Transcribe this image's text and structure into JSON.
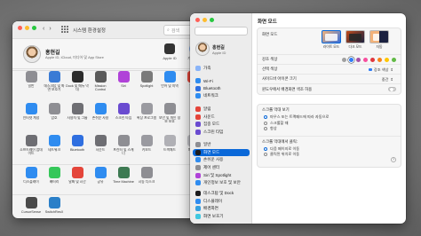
{
  "sysprefs": {
    "title": "시스템 환경설정",
    "search_placeholder": "검색",
    "account": {
      "name": "홍현길",
      "subtitle": "Apple ID, iCloud, 미디어 및 App Store",
      "tiles": [
        {
          "label": "Apple ID",
          "icon": "apple-icon"
        },
        {
          "label": "가족 공유",
          "icon": "family-icon"
        }
      ]
    },
    "rows": [
      [
        {
          "label": "일반",
          "icon": "general-icon",
          "color": "#8e8e93"
        },
        {
          "label": "데스크탑 및 화면 보호기",
          "icon": "desktop-icon",
          "color": "#3a7bd5"
        },
        {
          "label": "Dock 및 메뉴 막대",
          "icon": "dock-icon",
          "color": "#2b2b2b"
        },
        {
          "label": "Mission Control",
          "icon": "mission-control-icon",
          "color": "#5a5a5a"
        },
        {
          "label": "Siri",
          "icon": "siri-icon",
          "color": "#b042d8"
        },
        {
          "label": "Spotlight",
          "icon": "spotlight-icon",
          "color": "#7a7a7a"
        },
        {
          "label": "언어 및 지역",
          "icon": "globe-icon",
          "color": "#2f8cf0"
        },
        {
          "label": "알림",
          "icon": "bell-icon",
          "color": "#e4453a"
        }
      ],
      [
        {
          "label": "인터넷 계정",
          "icon": "at-icon",
          "color": "#2f8cf0"
        },
        {
          "label": "암호",
          "icon": "key-icon",
          "color": "#8e8e93"
        },
        {
          "label": "사용자 및 그룹",
          "icon": "users-icon",
          "color": "#6e6e73"
        },
        {
          "label": "손쉬운 사용",
          "icon": "accessibility-icon",
          "color": "#2f8cf0"
        },
        {
          "label": "스크린 타임",
          "icon": "hourglass-icon",
          "color": "#6a4bd0"
        },
        {
          "label": "확장 프로그램",
          "icon": "puzzle-icon",
          "color": "#9a9aa0"
        },
        {
          "label": "보안 및 개인 정보 보호",
          "icon": "house-icon",
          "color": "#8e8e93"
        }
      ],
      [
        {
          "label": "소프트웨어 업데이트",
          "icon": "gear-icon",
          "color": "#6e6e73"
        },
        {
          "label": "네트워크",
          "icon": "network-icon",
          "color": "#2f8cf0"
        },
        {
          "label": "Bluetooth",
          "icon": "bluetooth-icon",
          "color": "#2f6fe0"
        },
        {
          "label": "사운드",
          "icon": "speaker-icon",
          "color": "#6e6e73"
        },
        {
          "label": "프린터 및 스캐너",
          "icon": "printer-icon",
          "color": "#8e8e93"
        },
        {
          "label": "키보드",
          "icon": "keyboard-icon",
          "color": "#9a9aa0"
        },
        {
          "label": "트랙패드",
          "icon": "trackpad-icon",
          "color": "#b0b0b5"
        },
        {
          "label": "마우스",
          "icon": "mouse-icon",
          "color": "#c0c0c5"
        }
      ],
      [
        {
          "label": "디스플레이",
          "icon": "display-icon",
          "color": "#2f8cf0"
        },
        {
          "label": "배터리",
          "icon": "battery-icon",
          "color": "#35c759"
        },
        {
          "label": "날짜 및 시간",
          "icon": "clock-icon",
          "color": "#e4453a"
        },
        {
          "label": "공유",
          "icon": "sharing-icon",
          "color": "#2f8cf0"
        },
        {
          "label": "Time Machine",
          "icon": "time-machine-icon",
          "color": "#3d7a52"
        },
        {
          "label": "시동 디스크",
          "icon": "disk-icon",
          "color": "#8e8e93"
        }
      ],
      [
        {
          "label": "CursorSense",
          "icon": "cursorsense-icon",
          "color": "#4a4a4a"
        },
        {
          "label": "SwitchResX",
          "icon": "switchresx-icon",
          "color": "#2a7fc8"
        }
      ]
    ]
  },
  "appearance": {
    "sidebar_account": {
      "name": "홍현길",
      "subtitle": "Apple ID"
    },
    "sidebar_groups": [
      [
        {
          "label": "가족",
          "icon": "family-icon",
          "color": "#8ab4f8"
        }
      ],
      [
        {
          "label": "Wi-Fi",
          "icon": "wifi-icon",
          "color": "#2f8cf0"
        },
        {
          "label": "Bluetooth",
          "icon": "bluetooth-icon",
          "color": "#2f6fe0"
        },
        {
          "label": "네트워크",
          "icon": "network-icon",
          "color": "#2f8cf0"
        }
      ],
      [
        {
          "label": "알림",
          "icon": "bell-icon",
          "color": "#e4453a"
        },
        {
          "label": "사운드",
          "icon": "speaker-icon",
          "color": "#e4453a"
        },
        {
          "label": "집중 모드",
          "icon": "moon-icon",
          "color": "#6a4bd0"
        },
        {
          "label": "스크린 타임",
          "icon": "hourglass-icon",
          "color": "#6a4bd0"
        }
      ],
      [
        {
          "label": "일반",
          "icon": "gear-icon",
          "color": "#8e8e93"
        },
        {
          "label": "화면 모드",
          "icon": "appearance-icon",
          "color": "#1c1c1e",
          "selected": true
        },
        {
          "label": "손쉬운 사용",
          "icon": "accessibility-icon",
          "color": "#2f8cf0"
        },
        {
          "label": "제어 센터",
          "icon": "control-center-icon",
          "color": "#8e8e93"
        },
        {
          "label": "Siri 및 Spotlight",
          "icon": "siri-icon",
          "color": "#b042d8"
        },
        {
          "label": "개인정보 보호 및 보안",
          "icon": "hand-icon",
          "color": "#2f8cf0"
        }
      ],
      [
        {
          "label": "데스크탑 및 Dock",
          "icon": "dock-icon",
          "color": "#1c1c1e"
        },
        {
          "label": "디스플레이",
          "icon": "display-icon",
          "color": "#2f8cf0"
        },
        {
          "label": "배경화면",
          "icon": "wallpaper-icon",
          "color": "#35a0e0"
        },
        {
          "label": "화면 보호기",
          "icon": "screensaver-icon",
          "color": "#40c8e0"
        }
      ]
    ],
    "content": {
      "title": "화면 모드",
      "appearance_row_label": "화면 모드",
      "options": [
        {
          "label": "라이트 모드",
          "selected": true
        },
        {
          "label": "다크 모드",
          "selected": false
        },
        {
          "label": "자동",
          "selected": false
        }
      ],
      "accent_label": "강조 색상",
      "accent_colors": [
        "#a0a0a0",
        "#2f7cf6",
        "#a550a7",
        "#f74f9e",
        "#e0383e",
        "#f7821b",
        "#ffc600",
        "#62ba46"
      ],
      "highlight_label": "선택 색상",
      "highlight_value": "강조 색상",
      "sidebar_icon_label": "사이드바 아이콘 크기",
      "sidebar_icon_value": "중간",
      "wallpaper_tint_label": "윈도우에서 배경화면 색조 허용",
      "scroll_show_title": "스크롤 막대 보기",
      "scroll_show_options": [
        {
          "label": "마우스 또는 트랙패드에 따라 자동으로",
          "selected": true
        },
        {
          "label": "스크롤할 때",
          "selected": false
        },
        {
          "label": "항상",
          "selected": false
        }
      ],
      "scroll_click_title": "스크롤 막대에서 클릭:",
      "scroll_click_options": [
        {
          "label": "다음 페이지로 이동",
          "selected": true
        },
        {
          "label": "클릭된 위치로 이동",
          "selected": false
        }
      ],
      "help_label": "?"
    }
  }
}
